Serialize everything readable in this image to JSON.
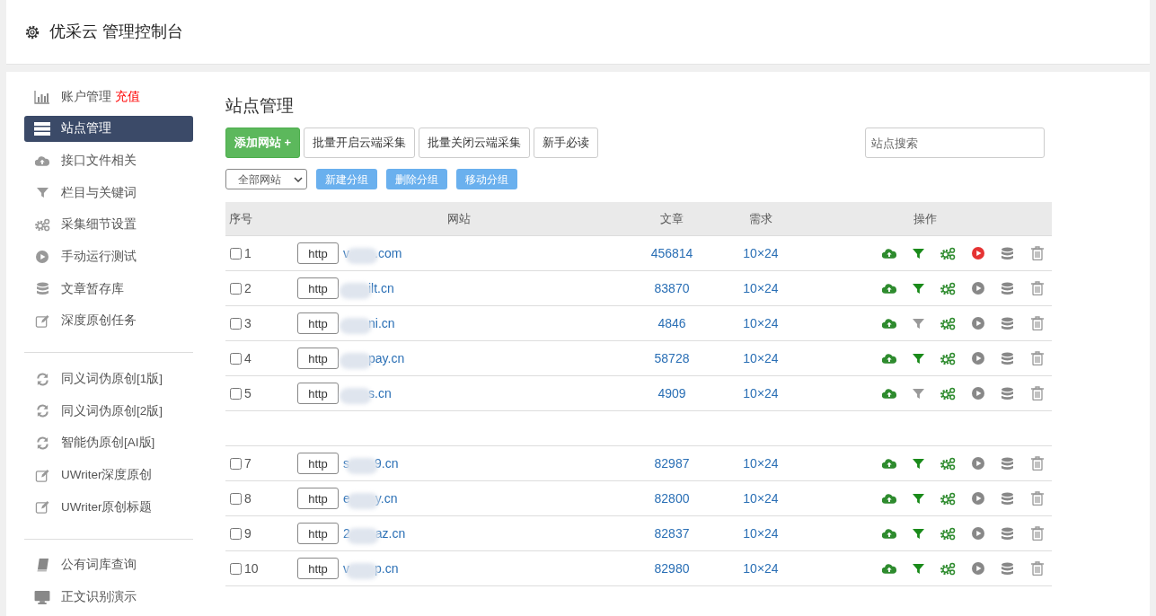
{
  "header": {
    "title": "优采云 管理控制台"
  },
  "sidebar": {
    "groups": [
      [
        {
          "kind": "chart",
          "label": "账户管理",
          "extra": "充值",
          "selected": false
        },
        {
          "kind": "server",
          "label": "站点管理",
          "selected": true
        },
        {
          "kind": "cloud",
          "label": "接口文件相关",
          "selected": false
        },
        {
          "kind": "filter",
          "label": "栏目与关键词",
          "selected": false
        },
        {
          "kind": "gears",
          "label": "采集细节设置",
          "selected": false
        },
        {
          "kind": "play",
          "label": "手动运行测试",
          "selected": false
        },
        {
          "kind": "database",
          "label": "文章暂存库",
          "selected": false
        },
        {
          "kind": "edit",
          "label": "深度原创任务",
          "selected": false
        }
      ],
      [
        {
          "kind": "refresh",
          "label": "同义词伪原创[1版]",
          "selected": false
        },
        {
          "kind": "refresh",
          "label": "同义词伪原创[2版]",
          "selected": false
        },
        {
          "kind": "refresh",
          "label": "智能伪原创[AI版]",
          "selected": false
        },
        {
          "kind": "edit",
          "label": "UWriter深度原创",
          "selected": false
        },
        {
          "kind": "edit",
          "label": "UWriter原创标题",
          "selected": false
        }
      ],
      [
        {
          "kind": "book",
          "label": "公有词库查询",
          "selected": false
        },
        {
          "kind": "monitor",
          "label": "正文识别演示",
          "selected": false
        }
      ]
    ]
  },
  "main": {
    "title": "站点管理",
    "buttons": [
      {
        "label": "添加网站 +",
        "kind": "primary"
      },
      {
        "label": "批量开启云端采集",
        "kind": "default"
      },
      {
        "label": "批量关闭云端采集",
        "kind": "default"
      },
      {
        "label": "新手必读",
        "kind": "default"
      }
    ],
    "search": {
      "placeholder": "站点搜索"
    },
    "group_select": "全部网站",
    "group_buttons": [
      "新建分组",
      "删除分组",
      "移动分组"
    ],
    "table": {
      "columns": [
        "序号",
        "网站",
        "文章",
        "需求",
        "操作"
      ],
      "rows": [
        {
          "kind": "row",
          "checked": false,
          "no": "1",
          "scheme": "http",
          "prefix": "v",
          "suffix": ".com",
          "articles": "456814",
          "demand": "10×24",
          "filter_on": true,
          "running": true
        },
        {
          "kind": "row",
          "checked": false,
          "no": "2",
          "scheme": "http",
          "prefix": "",
          "suffix": "ilt.cn",
          "articles": "83870",
          "demand": "10×24",
          "filter_on": true,
          "running": false
        },
        {
          "kind": "row",
          "checked": false,
          "no": "3",
          "scheme": "http",
          "prefix": "",
          "suffix": "ni.cn",
          "articles": "4846",
          "demand": "10×24",
          "filter_on": false,
          "running": false
        },
        {
          "kind": "row",
          "checked": false,
          "no": "4",
          "scheme": "http",
          "prefix": "",
          "suffix": "pay.cn",
          "articles": "58728",
          "demand": "10×24",
          "filter_on": true,
          "running": false
        },
        {
          "kind": "row",
          "checked": false,
          "no": "5",
          "scheme": "http",
          "prefix": "",
          "suffix": "s.cn",
          "articles": "4909",
          "demand": "10×24",
          "filter_on": false,
          "running": false
        },
        {
          "kind": "covered"
        },
        {
          "kind": "row",
          "checked": false,
          "no": "7",
          "scheme": "http",
          "prefix": "s",
          "suffix": "9.cn",
          "articles": "82987",
          "demand": "10×24",
          "filter_on": true,
          "running": false
        },
        {
          "kind": "row",
          "checked": false,
          "no": "8",
          "scheme": "http",
          "prefix": "e",
          "suffix": "y.cn",
          "articles": "82800",
          "demand": "10×24",
          "filter_on": true,
          "running": false
        },
        {
          "kind": "row",
          "checked": false,
          "no": "9",
          "scheme": "http",
          "prefix": "2",
          "suffix": "az.cn",
          "articles": "82837",
          "demand": "10×24",
          "filter_on": true,
          "running": false
        },
        {
          "kind": "row",
          "checked": false,
          "no": "10",
          "scheme": "http",
          "prefix": "v",
          "suffix": "p.cn",
          "articles": "82980",
          "demand": "10×24",
          "filter_on": true,
          "running": false
        }
      ]
    }
  }
}
